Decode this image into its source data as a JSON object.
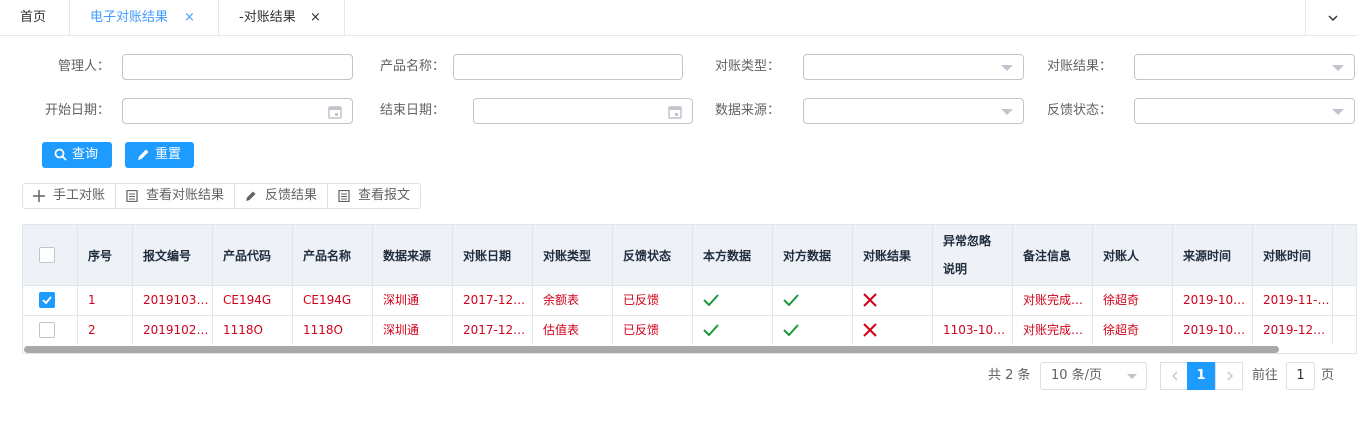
{
  "tabs": [
    {
      "label": "首页",
      "closable": false,
      "active": false
    },
    {
      "label": "电子对账结果",
      "closable": true,
      "active": true
    },
    {
      "label": "-对账结果",
      "closable": true,
      "active": false
    }
  ],
  "close_glyph": "×",
  "form": {
    "manager_label": "管理人：",
    "product_name_label": "产品名称：",
    "recon_type_label": "对账类型：",
    "recon_result_label": "对账结果：",
    "start_date_label": "开始日期：",
    "end_date_label": "结束日期：",
    "data_source_label": "数据来源：",
    "feedback_status_label": "反馈状态："
  },
  "buttons": {
    "query": "查询",
    "reset": "重置"
  },
  "toolbar": {
    "manual": "手工对账",
    "view_result": "查看对账结果",
    "feedback": "反馈结果",
    "view_message": "查看报文"
  },
  "table": {
    "headers": [
      "序号",
      "报文编号",
      "产品代码",
      "产品名称",
      "数据来源",
      "对账日期",
      "对账类型",
      "反馈状态",
      "本方数据",
      "对方数据",
      "对账结果",
      "异常忽略",
      "说明",
      "备注信息",
      "对账人",
      "来源时间",
      "对账时间"
    ],
    "rows": [
      {
        "checked": true,
        "cells": [
          "1",
          "2019103…",
          "CE194G",
          "CE194G",
          "深圳通",
          "2017-12…",
          "余额表",
          "已反馈",
          "",
          "",
          "",
          "",
          "对账完成…",
          "徐超奇",
          "2019-10…",
          "2019-11-…"
        ],
        "marks": [
          "check",
          "check",
          "cross"
        ]
      },
      {
        "checked": false,
        "cells": [
          "2",
          "2019102…",
          "1118O",
          "1118O",
          "深圳通",
          "2017-12…",
          "估值表",
          "已反馈",
          "",
          "",
          "",
          "1103-10…",
          "对账完成…",
          "徐超奇",
          "2019-10…",
          "2019-12…"
        ],
        "marks": [
          "check",
          "check",
          "cross"
        ]
      }
    ]
  },
  "pager": {
    "total": "共 2 条",
    "page_size": "10 条/页",
    "current": "1",
    "goto_prefix": "前往",
    "goto_value": "1",
    "goto_suffix": "页"
  },
  "colors": {
    "primary": "#1e9bff",
    "text_red": "#d0021b",
    "check_green": "#1a9a3a",
    "cross_red": "#d0021b"
  },
  "icons": {
    "query": "search-icon",
    "reset": "pencil-icon",
    "manual": "plus-icon",
    "view_result": "document-icon",
    "feedback": "pencil-icon",
    "view_message": "document-icon",
    "date": "calendar-icon",
    "select": "caret-down-icon"
  }
}
